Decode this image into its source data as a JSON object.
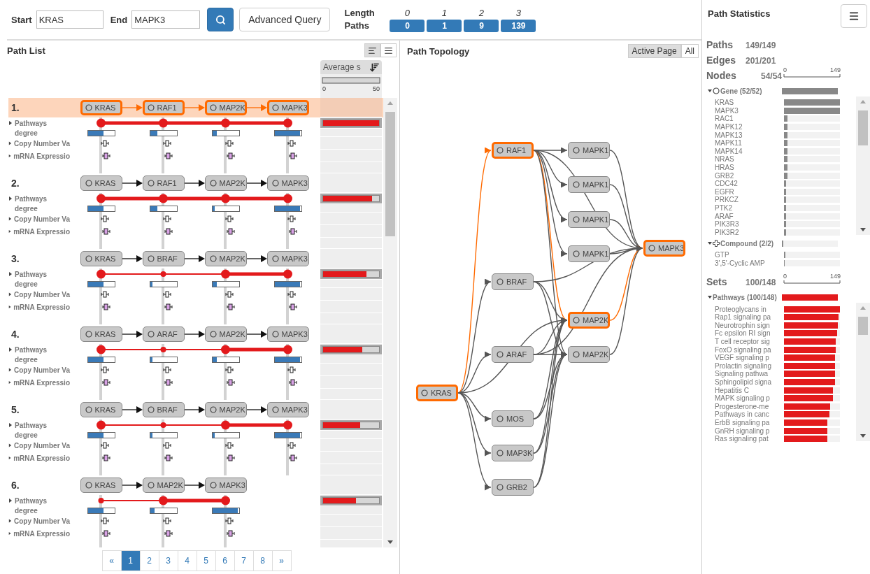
{
  "search": {
    "start_label": "Start",
    "start_value": "KRAS",
    "end_label": "End",
    "end_value": "MAPK3",
    "advanced_button": "Advanced Query"
  },
  "length_summary": {
    "length_label": "Length",
    "paths_label": "Paths",
    "columns": [
      {
        "length": "0",
        "paths": "0"
      },
      {
        "length": "1",
        "paths": "1"
      },
      {
        "length": "2",
        "paths": "9"
      },
      {
        "length": "3",
        "paths": "139"
      }
    ]
  },
  "path_list": {
    "title": "Path List",
    "view_toggles": [
      {
        "kind": "compact",
        "selected": true
      },
      {
        "kind": "full",
        "selected": false
      }
    ],
    "score_column": {
      "header": "Average s",
      "scale_min": "0",
      "scale_max": "50"
    },
    "paths": [
      {
        "number": "1.",
        "selected": true,
        "score": {
          "level": 1.0
        },
        "nodes": [
          {
            "label": "KRAS",
            "emphasized": true,
            "degree": {
              "level": 0.58
            }
          },
          {
            "label": "RAF1",
            "emphasized": true,
            "degree": {
              "level": 0.27
            }
          },
          {
            "label": "MAP2K",
            "emphasized": true,
            "degree": {
              "level": 0.17
            }
          },
          {
            "label": "MAPK3",
            "emphasized": true,
            "degree": {
              "level": 0.97
            }
          }
        ],
        "rows": [
          {
            "kind": "pathways",
            "label": "Pathways"
          },
          {
            "kind": "degree",
            "label": "degree"
          },
          {
            "kind": "copy_number",
            "label": "Copy Number Va"
          },
          {
            "kind": "mrna",
            "label": "mRNA Expressio"
          }
        ]
      },
      {
        "number": "2.",
        "selected": false,
        "score": {
          "level": 0.88
        },
        "nodes": [
          {
            "label": "KRAS",
            "emphasized": true,
            "degree": {
              "level": 0.58
            }
          },
          {
            "label": "RAF1",
            "emphasized": true,
            "degree": {
              "level": 0.27
            }
          },
          {
            "label": "MAP2K",
            "emphasized": true,
            "degree": {
              "level": 0.1
            }
          },
          {
            "label": "MAPK3",
            "emphasized": true,
            "degree": {
              "level": 0.97
            }
          }
        ],
        "rows": [
          {
            "kind": "pathways",
            "label": "Pathways"
          },
          {
            "kind": "degree",
            "label": "degree"
          },
          {
            "kind": "copy_number",
            "label": "Copy Number Va"
          },
          {
            "kind": "mrna",
            "label": "mRNA Expressio"
          }
        ]
      },
      {
        "number": "3.",
        "selected": false,
        "score": {
          "level": 0.78
        },
        "nodes": [
          {
            "label": "KRAS",
            "emphasized": true,
            "degree": {
              "level": 0.58
            }
          },
          {
            "label": "BRAF",
            "emphasized": false,
            "degree": {
              "level": 0.1
            }
          },
          {
            "label": "MAP2K",
            "emphasized": true,
            "degree": {
              "level": 0.17
            }
          },
          {
            "label": "MAPK3",
            "emphasized": true,
            "degree": {
              "level": 0.97
            }
          }
        ],
        "rows": [
          {
            "kind": "pathways",
            "label": "Pathways"
          },
          {
            "kind": "degree",
            "label": "degree"
          },
          {
            "kind": "copy_number",
            "label": "Copy Number Va"
          },
          {
            "kind": "mrna",
            "label": "mRNA Expressio"
          }
        ]
      },
      {
        "number": "4.",
        "selected": false,
        "score": {
          "level": 0.7
        },
        "nodes": [
          {
            "label": "KRAS",
            "emphasized": true,
            "degree": {
              "level": 0.58
            }
          },
          {
            "label": "ARAF",
            "emphasized": false,
            "degree": {
              "level": 0.1
            }
          },
          {
            "label": "MAP2K",
            "emphasized": true,
            "degree": {
              "level": 0.17
            }
          },
          {
            "label": "MAPK3",
            "emphasized": true,
            "degree": {
              "level": 0.97
            }
          }
        ],
        "rows": [
          {
            "kind": "pathways",
            "label": "Pathways"
          },
          {
            "kind": "degree",
            "label": "degree"
          },
          {
            "kind": "copy_number",
            "label": "Copy Number Va"
          },
          {
            "kind": "mrna",
            "label": "mRNA Expressio"
          }
        ]
      },
      {
        "number": "5.",
        "selected": false,
        "score": {
          "level": 0.66
        },
        "nodes": [
          {
            "label": "KRAS",
            "emphasized": true,
            "degree": {
              "level": 0.58
            }
          },
          {
            "label": "BRAF",
            "emphasized": false,
            "degree": {
              "level": 0.1
            }
          },
          {
            "label": "MAP2K",
            "emphasized": true,
            "degree": {
              "level": 0.1
            }
          },
          {
            "label": "MAPK3",
            "emphasized": true,
            "degree": {
              "level": 0.97
            }
          }
        ],
        "rows": [
          {
            "kind": "pathways",
            "label": "Pathways"
          },
          {
            "kind": "degree",
            "label": "degree"
          },
          {
            "kind": "copy_number",
            "label": "Copy Number Va"
          },
          {
            "kind": "mrna",
            "label": "mRNA Expressio"
          }
        ]
      },
      {
        "number": "6.",
        "selected": false,
        "score": {
          "level": 0.59
        },
        "nodes": [
          {
            "label": "KRAS",
            "emphasized": false,
            "degree": {
              "level": 0.58
            }
          },
          {
            "label": "MAP2K",
            "emphasized": true,
            "degree": {
              "level": 0.17
            }
          },
          {
            "label": "MAPK3",
            "emphasized": true,
            "degree": {
              "level": 0.97
            }
          }
        ],
        "rows": [
          {
            "kind": "pathways",
            "label": "Pathways"
          },
          {
            "kind": "degree",
            "label": "degree"
          },
          {
            "kind": "copy_number",
            "label": "Copy Number Va"
          },
          {
            "kind": "mrna",
            "label": "mRNA Expressio"
          }
        ]
      }
    ],
    "pagination": [
      {
        "label": "«",
        "selected": false
      },
      {
        "label": "1",
        "selected": true
      },
      {
        "label": "2",
        "selected": false
      },
      {
        "label": "3",
        "selected": false
      },
      {
        "label": "4",
        "selected": false
      },
      {
        "label": "5",
        "selected": false
      },
      {
        "label": "6",
        "selected": false
      },
      {
        "label": "7",
        "selected": false
      },
      {
        "label": "8",
        "selected": false
      },
      {
        "label": "»",
        "selected": false
      }
    ]
  },
  "topology": {
    "title": "Path Topology",
    "scope_toggles": [
      {
        "label": "Active Page",
        "selected": true
      },
      {
        "label": "All",
        "selected": false
      }
    ],
    "nodes": [
      {
        "label": "KRAS",
        "highlighted": true
      },
      {
        "label": "RAF1",
        "highlighted": true
      },
      {
        "label": "BRAF",
        "highlighted": false
      },
      {
        "label": "ARAF",
        "highlighted": false
      },
      {
        "label": "MOS",
        "highlighted": false
      },
      {
        "label": "MAP3K",
        "highlighted": false
      },
      {
        "label": "GRB2",
        "highlighted": false
      },
      {
        "label": "MAPK1",
        "highlighted": false
      },
      {
        "label": "MAPK1",
        "highlighted": false
      },
      {
        "label": "MAPK1",
        "highlighted": false
      },
      {
        "label": "MAPK1",
        "highlighted": false
      },
      {
        "label": "MAP2K",
        "highlighted": true
      },
      {
        "label": "MAP2K",
        "highlighted": false
      },
      {
        "label": "MAPK3",
        "highlighted": true
      }
    ]
  },
  "statistics": {
    "title": "Path Statistics",
    "summary": [
      {
        "label": "Paths",
        "value": "149/149"
      },
      {
        "label": "Edges",
        "value": "201/201"
      },
      {
        "label": "Nodes",
        "value": "54/54"
      }
    ],
    "node_axis": {
      "min": "0",
      "max": "149"
    },
    "node_groups": [
      {
        "kind": "gene",
        "label": "Gene (52/52)",
        "expanded": true,
        "level": 1.0,
        "items": [
          {
            "label": "KRAS",
            "level": 1.0
          },
          {
            "label": "MAPK3",
            "level": 1.0
          },
          {
            "label": "RAC1",
            "level": 0.06
          },
          {
            "label": "MAPK12",
            "level": 0.06
          },
          {
            "label": "MAPK13",
            "level": 0.06
          },
          {
            "label": "MAPK11",
            "level": 0.06
          },
          {
            "label": "MAPK14",
            "level": 0.06
          },
          {
            "label": "NRAS",
            "level": 0.06
          },
          {
            "label": "HRAS",
            "level": 0.06
          },
          {
            "label": "GRB2",
            "level": 0.06
          },
          {
            "label": "CDC42",
            "level": 0.04
          },
          {
            "label": "EGFR",
            "level": 0.04
          },
          {
            "label": "PRKCZ",
            "level": 0.04
          },
          {
            "label": "PTK2",
            "level": 0.04
          },
          {
            "label": "ARAF",
            "level": 0.04
          },
          {
            "label": "PIK3R3",
            "level": 0.04
          },
          {
            "label": "PIK3R2",
            "level": 0.04
          }
        ]
      },
      {
        "kind": "compound",
        "label": "Compound (2/2)",
        "expanded": true,
        "level": 0.03,
        "items": [
          {
            "label": "GTP",
            "level": 0.02
          },
          {
            "label": "3',5'-Cyclic AMP",
            "level": 0.01
          }
        ]
      }
    ],
    "sets": {
      "label": "Sets",
      "value": "100/148",
      "axis_min": "0",
      "axis_max": "149",
      "groups": [
        {
          "label": "Pathways (100/148)",
          "expanded": true,
          "level": 1.0,
          "items": [
            {
              "label": "Proteoglycans in",
              "level": 1.0
            },
            {
              "label": "Rap1 signaling pa",
              "level": 0.97
            },
            {
              "label": "Neurotrophin sign",
              "level": 0.96
            },
            {
              "label": "Fc epsilon RI sign",
              "level": 0.95
            },
            {
              "label": "T cell receptor sig",
              "level": 0.93
            },
            {
              "label": "FoxO signaling pa",
              "level": 0.92
            },
            {
              "label": "VEGF signaling p",
              "level": 0.91
            },
            {
              "label": "Prolactin signaling",
              "level": 0.91
            },
            {
              "label": "Signaling pathwa",
              "level": 0.91
            },
            {
              "label": "Sphingolipid signa",
              "level": 0.91
            },
            {
              "label": "Hepatitis C",
              "level": 0.88
            },
            {
              "label": "MAPK signaling p",
              "level": 0.88
            },
            {
              "label": "Progesterone-me",
              "level": 0.82
            },
            {
              "label": "Pathways in canc",
              "level": 0.81
            },
            {
              "label": "ErbB signaling pa",
              "level": 0.78
            },
            {
              "label": "GnRH signaling p",
              "level": 0.77
            },
            {
              "label": "Ras signaling pat",
              "level": 0.77
            }
          ]
        }
      ]
    }
  }
}
